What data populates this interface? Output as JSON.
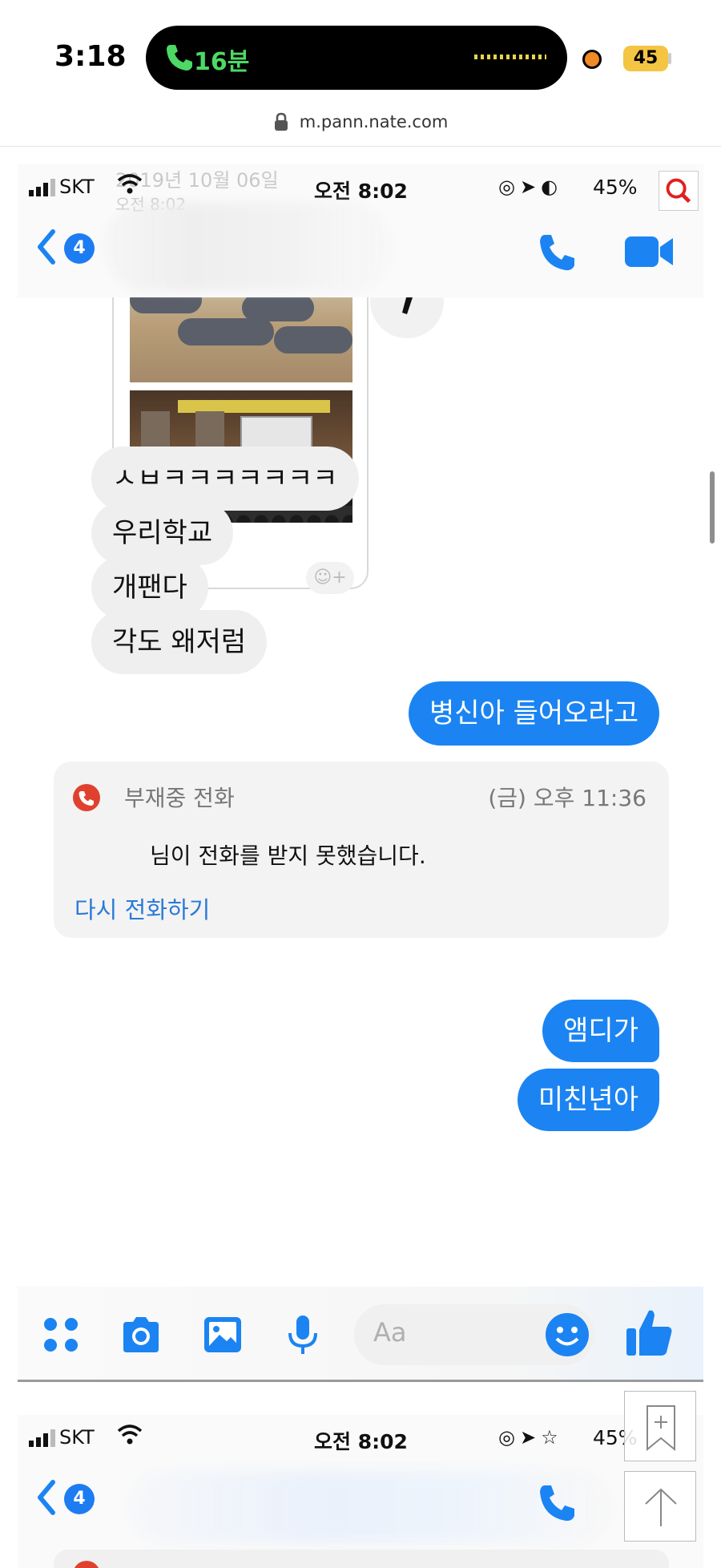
{
  "outer_status": {
    "time": "3:18",
    "call_duration": "16분",
    "battery": "45"
  },
  "browser": {
    "url": "m.pann.nate.com"
  },
  "screenshot1": {
    "status": {
      "carrier": "SKT",
      "time": "오전 8:02",
      "battery": "45%",
      "ghost_date": "2019년 10월 06일",
      "ghost_time": "오전 8:02"
    },
    "header": {
      "unread_count": "4"
    },
    "photo_message": {
      "share_glyph": "←",
      "react_label": "☺+"
    },
    "messages_in": [
      "ㅅㅂㅋㅋㅋㅋㅋㅋㅋ",
      "우리학교",
      "개팬다",
      "각도 왜저럼"
    ],
    "message_out_1": "병신아 들어오라고",
    "missed_call": {
      "title": "부재중 전화",
      "time": "(금) 오후 11:36",
      "body": "님이 전화를 받지 못했습니다.",
      "action": "다시 전화하기"
    },
    "messages_out_2": [
      "앰디가",
      "미친년아"
    ],
    "composer": {
      "placeholder": "Aa"
    }
  },
  "screenshot2": {
    "status": {
      "carrier": "SKT",
      "time": "오전 8:02",
      "battery": "45%"
    },
    "header": {
      "unread_count": "4"
    }
  },
  "colors": {
    "messenger_blue": "#1b84f2",
    "missed_red": "#e0412f",
    "call_green": "#4cd964"
  }
}
